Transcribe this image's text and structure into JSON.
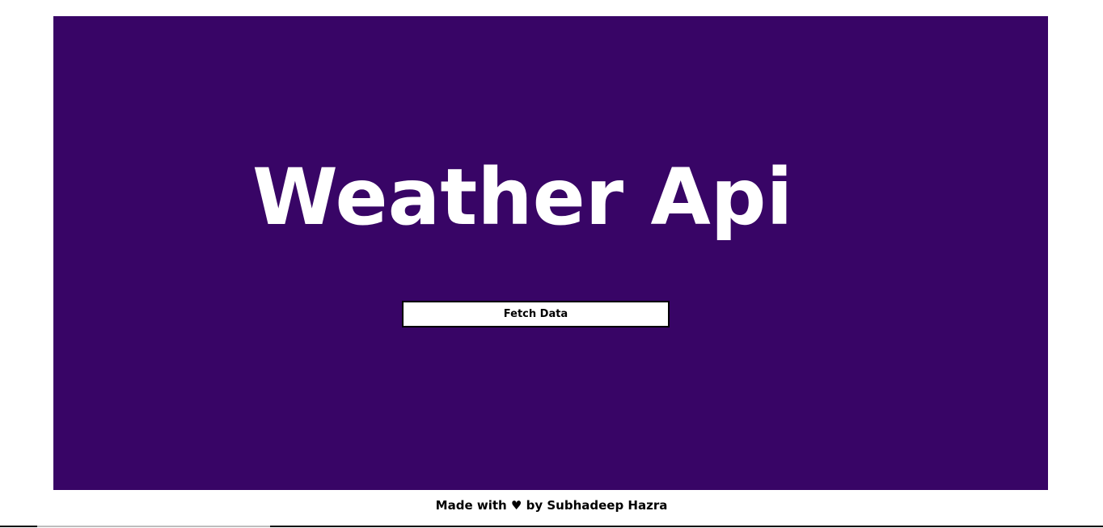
{
  "hero": {
    "title": "Weather Api",
    "button_label": "Fetch Data",
    "background": "#380566",
    "text_color": "#ffffff"
  },
  "footer": {
    "prefix": "Made with",
    "heart_icon": "heart-icon",
    "suffix": "by Subhadeep Hazra"
  }
}
